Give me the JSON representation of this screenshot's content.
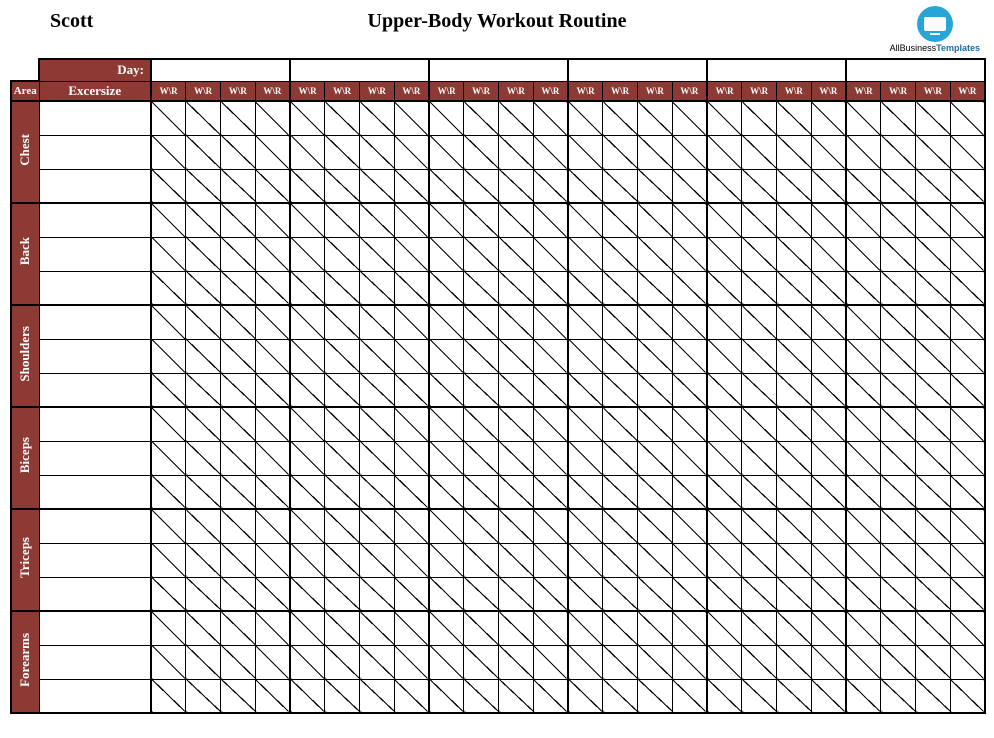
{
  "header": {
    "name": "Scott",
    "title": "Upper-Body Workout Routine",
    "logo_line1": "AllBusiness",
    "logo_line2": "Templates"
  },
  "labels": {
    "day": "Day:",
    "area": "Area",
    "exercise": "Excersize",
    "wr": "W\\R"
  },
  "areas": [
    {
      "name": "Chest",
      "rows": 3
    },
    {
      "name": "Back",
      "rows": 3
    },
    {
      "name": "Shoulders",
      "rows": 3
    },
    {
      "name": "Biceps",
      "rows": 3
    },
    {
      "name": "Triceps",
      "rows": 3
    },
    {
      "name": "Forearms",
      "rows": 3
    }
  ],
  "day_groups": 6,
  "cols_per_group": 4
}
